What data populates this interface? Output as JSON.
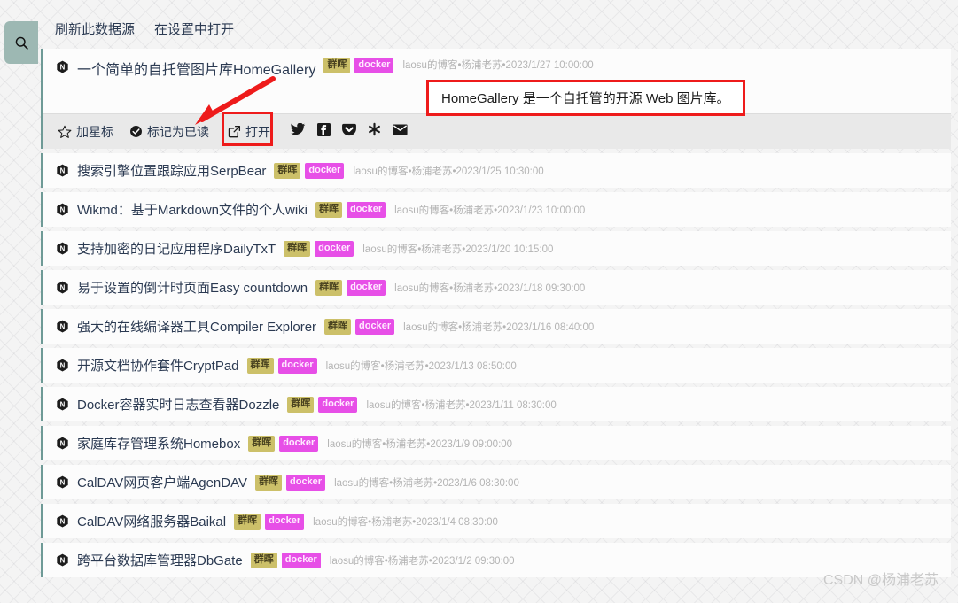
{
  "sidebar": {
    "search_icon": "search-icon"
  },
  "toolbar": {
    "refresh_source_label": "刷新此数据源",
    "open_in_settings_label": "在设置中打开"
  },
  "colors": {
    "accent_bar": "#6e9a96",
    "search_button_bg": "#9db8b3",
    "tag_synology_bg": "#ccc069",
    "tag_docker_bg": "#e74fe7",
    "annotation_red": "#ee1b1b",
    "title_text": "#2b3a52",
    "meta_text": "#b4b4b4"
  },
  "expanded_entry": {
    "favicon": "hexagon-n-icon",
    "title": "一个简单的自托管图片库HomeGallery",
    "tags": [
      "群晖",
      "docker"
    ],
    "meta": "laosu的博客•杨浦老苏•2023/1/27 10:00:00",
    "actions": {
      "star_label": "加星标",
      "star_icon": "star-icon",
      "mark_read_label": "标记为已读",
      "mark_read_icon": "check-circle-icon",
      "open_label": "打开",
      "open_icon": "external-link-icon"
    },
    "social": [
      {
        "name": "twitter-icon"
      },
      {
        "name": "facebook-icon"
      },
      {
        "name": "pocket-icon"
      },
      {
        "name": "asterisk-icon"
      },
      {
        "name": "email-icon"
      }
    ]
  },
  "callout": {
    "text": "HomeGallery 是一个自托管的开源 Web 图片库。"
  },
  "entries": [
    {
      "favicon": "hexagon-n-icon",
      "title": "搜索引擎位置跟踪应用SerpBear",
      "tags": [
        "群晖",
        "docker"
      ],
      "meta": "laosu的博客•杨浦老苏•2023/1/25 10:30:00"
    },
    {
      "favicon": "hexagon-n-icon",
      "title": "Wikmd：基于Markdown文件的个人wiki",
      "tags": [
        "群晖",
        "docker"
      ],
      "meta": "laosu的博客•杨浦老苏•2023/1/23 10:00:00"
    },
    {
      "favicon": "hexagon-n-icon",
      "title": "支持加密的日记应用程序DailyTxT",
      "tags": [
        "群晖",
        "docker"
      ],
      "meta": "laosu的博客•杨浦老苏•2023/1/20 10:15:00"
    },
    {
      "favicon": "hexagon-n-icon",
      "title": "易于设置的倒计时页面Easy countdown",
      "tags": [
        "群晖",
        "docker"
      ],
      "meta": "laosu的博客•杨浦老苏•2023/1/18 09:30:00"
    },
    {
      "favicon": "hexagon-n-icon",
      "title": "强大的在线编译器工具Compiler Explorer",
      "tags": [
        "群晖",
        "docker"
      ],
      "meta": "laosu的博客•杨浦老苏•2023/1/16 08:40:00"
    },
    {
      "favicon": "hexagon-n-icon",
      "title": "开源文档协作套件CryptPad",
      "tags": [
        "群晖",
        "docker"
      ],
      "meta": "laosu的博客•杨浦老苏•2023/1/13 08:50:00"
    },
    {
      "favicon": "hexagon-n-icon",
      "title": "Docker容器实时日志查看器Dozzle",
      "tags": [
        "群晖",
        "docker"
      ],
      "meta": "laosu的博客•杨浦老苏•2023/1/11 08:30:00"
    },
    {
      "favicon": "hexagon-n-icon",
      "title": "家庭库存管理系统Homebox",
      "tags": [
        "群晖",
        "docker"
      ],
      "meta": "laosu的博客•杨浦老苏•2023/1/9 09:00:00"
    },
    {
      "favicon": "hexagon-n-icon",
      "title": "CalDAV网页客户端AgenDAV",
      "tags": [
        "群晖",
        "docker"
      ],
      "meta": "laosu的博客•杨浦老苏•2023/1/6 08:30:00"
    },
    {
      "favicon": "hexagon-n-icon",
      "title": "CalDAV网络服务器Baikal",
      "tags": [
        "群晖",
        "docker"
      ],
      "meta": "laosu的博客•杨浦老苏•2023/1/4 08:30:00"
    },
    {
      "favicon": "hexagon-n-icon",
      "title": "跨平台数据库管理器DbGate",
      "tags": [
        "群晖",
        "docker"
      ],
      "meta": "laosu的博客•杨浦老苏•2023/1/2 09:30:00"
    }
  ],
  "watermark": {
    "text": "CSDN @杨浦老苏"
  }
}
